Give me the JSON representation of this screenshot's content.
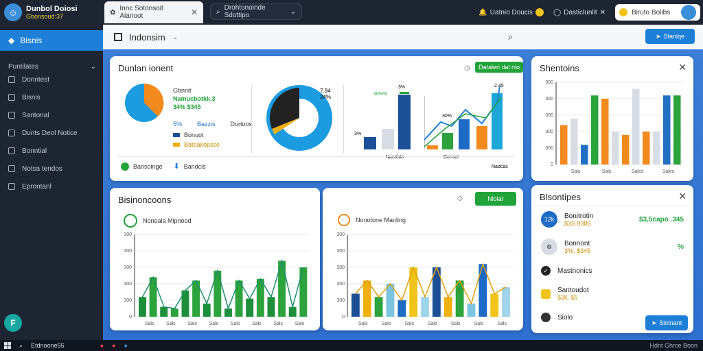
{
  "sidebar": {
    "brand_title": "Dunbol Doiosi",
    "brand_subtitle": "Gbonsoud:37",
    "active_item": "Bisnis",
    "section": "Puntilates",
    "items": [
      {
        "label": "Donntest",
        "icon": "briefcase-icon"
      },
      {
        "label": "Bisnis",
        "icon": "document-icon"
      },
      {
        "label": "Santonal",
        "icon": "chart-icon"
      },
      {
        "label": "Dunts Deol Notice",
        "icon": "bookmark-icon"
      },
      {
        "label": "Bonntial",
        "icon": "list-icon"
      },
      {
        "label": "Notsa tendos",
        "icon": "calendar-icon"
      },
      {
        "label": "Eprontanl",
        "icon": "mail-icon"
      }
    ],
    "fab_label": "F"
  },
  "topbar": {
    "tab_label": "Innc Sotonsoit Alanoot",
    "search_text": "Drohtonoinde Sdottipo",
    "right_item1": "Uatnio Doucis",
    "right_item2": "Dasticlunlit",
    "user_label": "Biruto Bolibs"
  },
  "header": {
    "title": "Indonsim",
    "button_label": "Stanlqe"
  },
  "card_main": {
    "title": "Dunlan ionent",
    "button_label": "Dataleri dal nio",
    "pie_legend_title": "Gbnnit",
    "pie_legend_value": "Namucbotkk.3",
    "pie_legend_sub": "34% $345",
    "pie_percent": "5%",
    "pie_series1": "Bazzis",
    "pie_series2": "Dortoos",
    "pie_legend2a": "Bonuot",
    "pie_legend2b": "Bateakopsse",
    "donut_label": "7.94",
    "donut_label2": "24%",
    "bar1_label": "30%%",
    "bar1_sub": "3%",
    "bar1_top": "3%",
    "bar1_x": "Nandsto",
    "bar2_label": "30%",
    "bar2_top": "2.45",
    "bar2_x": "Donsot",
    "bar2_x2": "Nadcas",
    "footer1": "Bansoinge",
    "footer2": "Bandcis"
  },
  "card_right_top": {
    "title": "Shentoins",
    "y_ticks": [
      "300",
      "300",
      "300",
      "300",
      "300",
      "0"
    ],
    "x_ticks": [
      "Sals",
      "Sals",
      "Sales",
      "Sales"
    ],
    "colors": [
      "#f28a1e",
      "#d8dde5",
      "#2270c4",
      "#2ca33c",
      "#f28a1e",
      "#d8dde5",
      "#f28a1e",
      "#d8dde5"
    ],
    "chart_data": {
      "type": "bar",
      "values": [
        120,
        140,
        60,
        210,
        200,
        100,
        90,
        230,
        100,
        100,
        210,
        210
      ]
    }
  },
  "card_bottom_left": {
    "title": "Bisinoncoons",
    "chart_title": "Nonoala Mipnood",
    "y_ticks": [
      "300",
      "300",
      "300",
      "300",
      "300",
      "0"
    ],
    "x_ticks": [
      "Sals",
      "Sals",
      "Sals",
      "Sals",
      "Sals",
      "Sals",
      "Sals",
      "Sals"
    ],
    "chart_data": {
      "type": "bar",
      "values": [
        60,
        120,
        30,
        25,
        80,
        110,
        40,
        140,
        25,
        110,
        55,
        115,
        60,
        170,
        30,
        150
      ]
    }
  },
  "card_bottom_mid": {
    "chart_title": "Nonotone Manling",
    "button_label": "Nlolar",
    "y_ticks": [
      "300",
      "300",
      "300",
      "300",
      "300",
      "0"
    ],
    "x_ticks": [
      "Sals",
      "Sals",
      "Sals",
      "Sals",
      "Sals",
      "Sals",
      "Sals"
    ],
    "chart_data": {
      "type": "bar",
      "values": [
        70,
        110,
        60,
        100,
        50,
        150,
        60,
        150,
        60,
        110,
        40,
        160,
        70,
        90
      ]
    }
  },
  "card_right_bottom": {
    "title": "Blsontipes",
    "rows": [
      {
        "title": "Bonitrotin",
        "sub": "$3S.9385",
        "value": "$3,5capo .345",
        "icon_color": "#1d6bc4",
        "icon_text": "12k"
      },
      {
        "title": "Bonnont",
        "sub": "3%, $345",
        "value": "%",
        "icon_color": "#d8dde5",
        "icon_text": "⚙"
      },
      {
        "title": "Mastnonics",
        "sub": "",
        "value": "",
        "icon_color": "#222222",
        "icon_text": "✓"
      },
      {
        "title": "Santoudot",
        "sub": "$3ll, $5",
        "value": "",
        "icon_color": "#f0c419",
        "icon_text": ""
      },
      {
        "title": "Siolo",
        "sub": "",
        "value": "",
        "icon_color": "#333333",
        "icon_text": ""
      }
    ],
    "button_label": "Siotnant"
  },
  "taskbar": {
    "search_text": "Etdnoone55",
    "tray": "Hdnt Ghrce Boon"
  }
}
